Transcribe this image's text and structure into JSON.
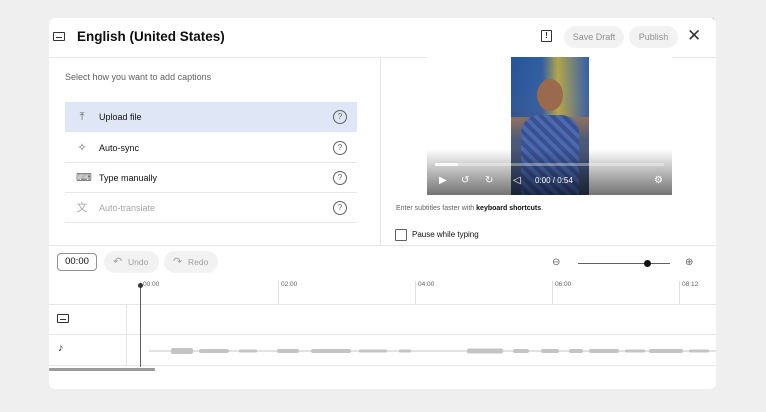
{
  "header": {
    "title": "English (United States)",
    "save_draft_label": "Save Draft",
    "publish_label": "Publish"
  },
  "left": {
    "instruction": "Select how you want to add captions",
    "options": [
      {
        "label": "Upload file",
        "icon": "upload-icon",
        "selected": true
      },
      {
        "label": "Auto-sync",
        "icon": "sparkle-icon"
      },
      {
        "label": "Type manually",
        "icon": "keyboard-icon"
      },
      {
        "label": "Auto-translate",
        "icon": "translate-icon",
        "disabled": true
      }
    ]
  },
  "video": {
    "time": "0:00 / 0:54",
    "progress": 0.1
  },
  "hint": {
    "prefix": "Enter subtitles faster with ",
    "link": "keyboard shortcuts",
    "suffix": "."
  },
  "pause_label": "Pause while typing",
  "toolbar": {
    "time_value": "00:00",
    "undo_label": "Undo",
    "redo_label": "Redo",
    "zoom_level": 0.75
  },
  "ruler": {
    "ticks": [
      "00:00",
      "02:00",
      "04:00",
      "06:00",
      "08:12"
    ]
  },
  "colors": {
    "selected_row": "#dfe7f7",
    "accent": "#065fd4"
  }
}
